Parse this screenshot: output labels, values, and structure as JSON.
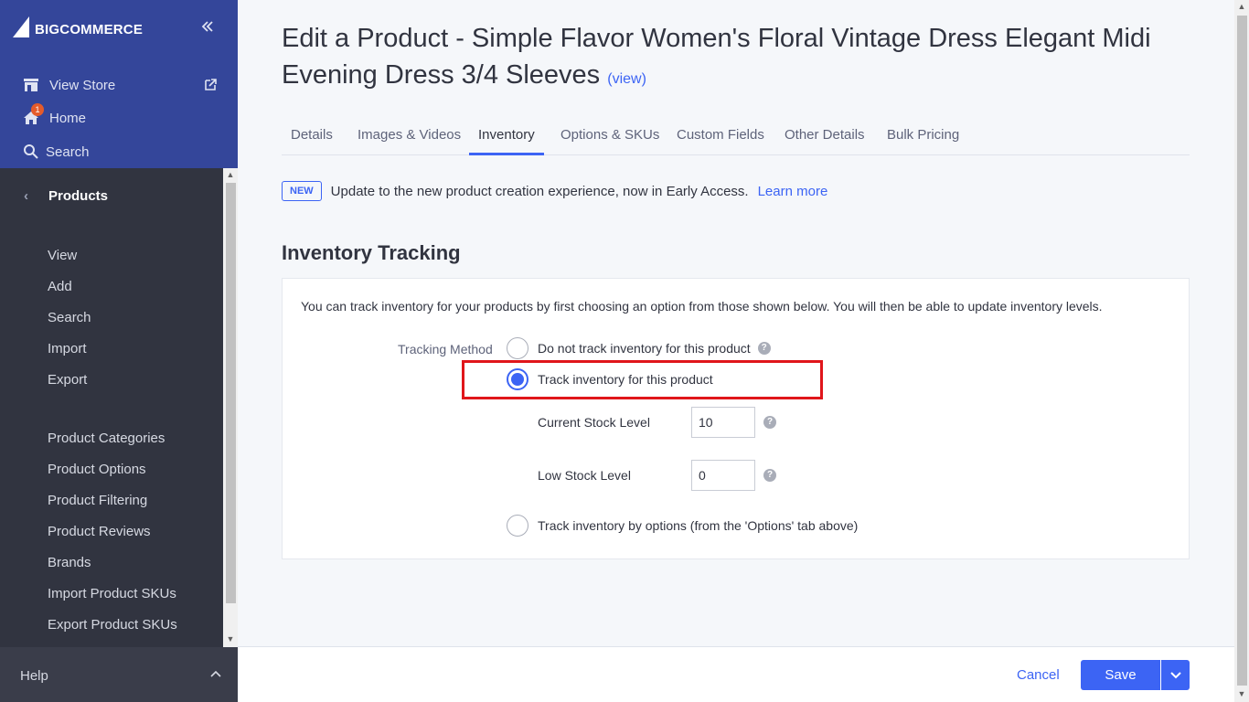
{
  "brand": {
    "logo_text": "COMMERCE",
    "logo_prefix": "BIG"
  },
  "sidebar": {
    "collapse_icon": "double-chevron-left-icon",
    "top_items": [
      {
        "label": "View Store",
        "icon": "storefront-icon"
      },
      {
        "label": "Home",
        "icon": "home-icon",
        "badge": "1"
      },
      {
        "label": "Search",
        "icon": "search-icon"
      }
    ],
    "section": {
      "title": "Products",
      "items": [
        "View",
        "Add",
        "Search",
        "Import",
        "Export"
      ],
      "items2": [
        "Product Categories",
        "Product Options",
        "Product Filtering",
        "Product Reviews",
        "Brands",
        "Import Product SKUs",
        "Export Product SKUs"
      ]
    },
    "help_label": "Help"
  },
  "page": {
    "title": "Edit a Product - Simple Flavor Women's Floral Vintage Dress Elegant Midi Evening Dress 3/4 Sleeves",
    "view_link": "(view)",
    "tabs": [
      {
        "label": "Details"
      },
      {
        "label": "Images & Videos"
      },
      {
        "label": "Inventory",
        "active": true
      },
      {
        "label": "Options & SKUs"
      },
      {
        "label": "Custom Fields"
      },
      {
        "label": "Other Details"
      },
      {
        "label": "Bulk Pricing"
      }
    ],
    "notice": {
      "pill": "NEW",
      "text": "Update to the new product creation experience, now in Early Access.",
      "link": "Learn more"
    },
    "section_title": "Inventory Tracking",
    "description": "You can track inventory for your products by first choosing an option from those shown below. You will then be able to update inventory levels.",
    "tracking_method_label": "Tracking Method",
    "options": [
      {
        "label": "Do not track inventory for this product",
        "checked": false
      },
      {
        "label": "Track inventory for this product",
        "checked": true
      },
      {
        "label": "Track inventory by options (from the 'Options' tab above)",
        "checked": false
      }
    ],
    "fields": {
      "current_stock": {
        "label": "Current Stock Level",
        "value": "10"
      },
      "low_stock": {
        "label": "Low Stock Level",
        "value": "0"
      }
    },
    "help_glyph": "?"
  },
  "footer": {
    "cancel_label": "Cancel",
    "save_label": "Save"
  },
  "colors": {
    "sidebar_top": "#34469a",
    "sidebar": "#313440",
    "accent": "#3c64f4",
    "highlight": "#e0161b",
    "badge": "#e45b2b"
  }
}
